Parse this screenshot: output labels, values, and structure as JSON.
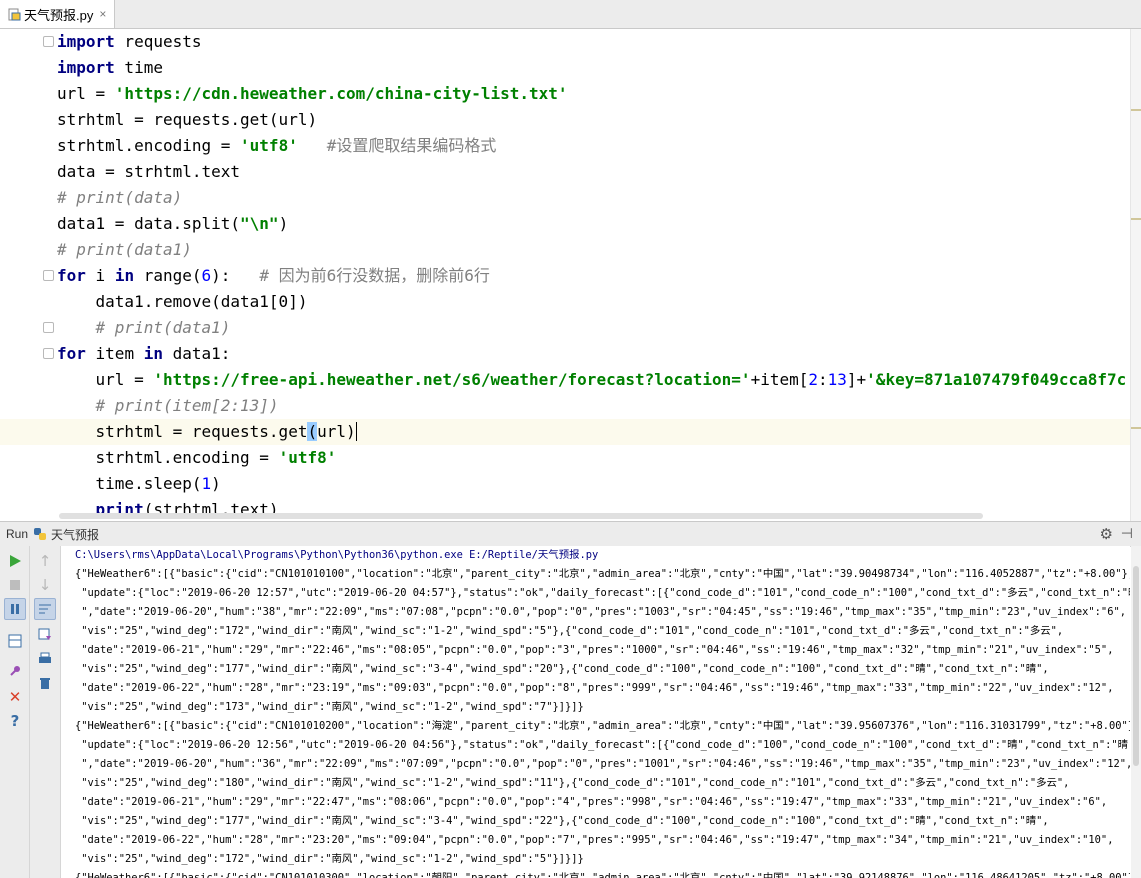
{
  "tab": {
    "filename": "天气预报.py",
    "close": "×"
  },
  "editor": {
    "lines": [
      {
        "segs": [
          [
            "kw",
            "import"
          ],
          [
            "t",
            " requests"
          ]
        ]
      },
      {
        "segs": [
          [
            "kw",
            "import"
          ],
          [
            "t",
            " time"
          ]
        ]
      },
      {
        "segs": [
          [
            "t",
            "url = "
          ],
          [
            "str",
            "'https://cdn.heweather.com/china-city-list.txt'"
          ]
        ]
      },
      {
        "segs": [
          [
            "t",
            "strhtml = requests.get(url)"
          ]
        ]
      },
      {
        "segs": [
          [
            "t",
            "strhtml.encoding = "
          ],
          [
            "str",
            "'utf8'"
          ],
          [
            "t",
            "   "
          ],
          [
            "cmtcn",
            "#设置爬取结果编码格式"
          ]
        ]
      },
      {
        "segs": [
          [
            "t",
            "data = strhtml.text"
          ]
        ]
      },
      {
        "segs": [
          [
            "cmt",
            "# print(data)"
          ]
        ]
      },
      {
        "segs": [
          [
            "t",
            "data1 = data.split("
          ],
          [
            "str",
            "\"\\n\""
          ],
          [
            "t",
            ")"
          ]
        ]
      },
      {
        "segs": [
          [
            "cmt",
            "# print(data1)"
          ]
        ]
      },
      {
        "segs": [
          [
            "kw",
            "for"
          ],
          [
            "t",
            " i "
          ],
          [
            "kw",
            "in"
          ],
          [
            "t",
            " range("
          ],
          [
            "num",
            "6"
          ],
          [
            "t",
            "):   "
          ],
          [
            "cmtcn",
            "# 因为前6行没数据，删除前6行"
          ]
        ]
      },
      {
        "segs": [
          [
            "t",
            "    data1.remove(data1[0])"
          ]
        ]
      },
      {
        "segs": [
          [
            "t",
            "    "
          ],
          [
            "cmt",
            "# print(data1)"
          ]
        ]
      },
      {
        "segs": [
          [
            "kw",
            "for"
          ],
          [
            "t",
            " item "
          ],
          [
            "kw",
            "in"
          ],
          [
            "t",
            " data1:"
          ]
        ]
      },
      {
        "segs": [
          [
            "t",
            "    url = "
          ],
          [
            "str",
            "'https://free-api.heweather.net/s6/weather/forecast?location='"
          ],
          [
            "t",
            "+item["
          ],
          [
            "num",
            "2"
          ],
          [
            "t",
            ":"
          ],
          [
            "num",
            "13"
          ],
          [
            "t",
            "]+"
          ],
          [
            "str",
            "'&key=871a107479f049cca8f7c"
          ]
        ]
      },
      {
        "segs": [
          [
            "t",
            "    "
          ],
          [
            "cmt",
            "# print(item[2:13])"
          ]
        ]
      },
      {
        "segs": [
          [
            "t",
            "    strhtml = requests.get"
          ],
          [
            "br",
            "("
          ],
          [
            "t",
            "url"
          ],
          [
            "brc",
            ")"
          ]
        ]
      },
      {
        "segs": [
          [
            "t",
            "    strhtml.encoding = "
          ],
          [
            "str",
            "'utf8'"
          ]
        ]
      },
      {
        "segs": [
          [
            "t",
            "    time.sleep("
          ],
          [
            "num",
            "1"
          ],
          [
            "t",
            ")"
          ]
        ]
      },
      {
        "segs": [
          [
            "t",
            "    "
          ],
          [
            "kw2",
            "print"
          ],
          [
            "t",
            "(strhtml.text)"
          ]
        ]
      }
    ]
  },
  "run": {
    "label": "Run",
    "config_name": "天气预报",
    "output": [
      "C:\\Users\\rms\\AppData\\Local\\Programs\\Python\\Python36\\python.exe E:/Reptile/天气预报.py",
      "{\"HeWeather6\":[{\"basic\":{\"cid\":\"CN101010100\",\"location\":\"北京\",\"parent_city\":\"北京\",\"admin_area\":\"北京\",\"cnty\":\"中国\",\"lat\":\"39.90498734\",\"lon\":\"116.4052887\",\"tz\":\"+8.00\"},",
      " \"update\":{\"loc\":\"2019-06-20 12:57\",\"utc\":\"2019-06-20 04:57\"},\"status\":\"ok\",\"daily_forecast\":[{\"cond_code_d\":\"101\",\"cond_code_n\":\"100\",\"cond_txt_d\":\"多云\",\"cond_txt_n\":\"晴",
      " \",\"date\":\"2019-06-20\",\"hum\":\"38\",\"mr\":\"22:09\",\"ms\":\"07:08\",\"pcpn\":\"0.0\",\"pop\":\"0\",\"pres\":\"1003\",\"sr\":\"04:45\",\"ss\":\"19:46\",\"tmp_max\":\"35\",\"tmp_min\":\"23\",\"uv_index\":\"6\",",
      " \"vis\":\"25\",\"wind_deg\":\"172\",\"wind_dir\":\"南风\",\"wind_sc\":\"1-2\",\"wind_spd\":\"5\"},{\"cond_code_d\":\"101\",\"cond_code_n\":\"101\",\"cond_txt_d\":\"多云\",\"cond_txt_n\":\"多云\",",
      " \"date\":\"2019-06-21\",\"hum\":\"29\",\"mr\":\"22:46\",\"ms\":\"08:05\",\"pcpn\":\"0.0\",\"pop\":\"3\",\"pres\":\"1000\",\"sr\":\"04:46\",\"ss\":\"19:46\",\"tmp_max\":\"32\",\"tmp_min\":\"21\",\"uv_index\":\"5\",",
      " \"vis\":\"25\",\"wind_deg\":\"177\",\"wind_dir\":\"南风\",\"wind_sc\":\"3-4\",\"wind_spd\":\"20\"},{\"cond_code_d\":\"100\",\"cond_code_n\":\"100\",\"cond_txt_d\":\"晴\",\"cond_txt_n\":\"晴\",",
      " \"date\":\"2019-06-22\",\"hum\":\"28\",\"mr\":\"23:19\",\"ms\":\"09:03\",\"pcpn\":\"0.0\",\"pop\":\"8\",\"pres\":\"999\",\"sr\":\"04:46\",\"ss\":\"19:46\",\"tmp_max\":\"33\",\"tmp_min\":\"22\",\"uv_index\":\"12\",",
      " \"vis\":\"25\",\"wind_deg\":\"173\",\"wind_dir\":\"南风\",\"wind_sc\":\"1-2\",\"wind_spd\":\"7\"}]}]}",
      "{\"HeWeather6\":[{\"basic\":{\"cid\":\"CN101010200\",\"location\":\"海淀\",\"parent_city\":\"北京\",\"admin_area\":\"北京\",\"cnty\":\"中国\",\"lat\":\"39.95607376\",\"lon\":\"116.31031799\",\"tz\":\"+8.00\"},",
      " \"update\":{\"loc\":\"2019-06-20 12:56\",\"utc\":\"2019-06-20 04:56\"},\"status\":\"ok\",\"daily_forecast\":[{\"cond_code_d\":\"100\",\"cond_code_n\":\"100\",\"cond_txt_d\":\"晴\",\"cond_txt_n\":\"晴",
      " \",\"date\":\"2019-06-20\",\"hum\":\"36\",\"mr\":\"22:09\",\"ms\":\"07:09\",\"pcpn\":\"0.0\",\"pop\":\"0\",\"pres\":\"1001\",\"sr\":\"04:46\",\"ss\":\"19:46\",\"tmp_max\":\"35\",\"tmp_min\":\"23\",\"uv_index\":\"12\",",
      " \"vis\":\"25\",\"wind_deg\":\"180\",\"wind_dir\":\"南风\",\"wind_sc\":\"1-2\",\"wind_spd\":\"11\"},{\"cond_code_d\":\"101\",\"cond_code_n\":\"101\",\"cond_txt_d\":\"多云\",\"cond_txt_n\":\"多云\",",
      " \"date\":\"2019-06-21\",\"hum\":\"29\",\"mr\":\"22:47\",\"ms\":\"08:06\",\"pcpn\":\"0.0\",\"pop\":\"4\",\"pres\":\"998\",\"sr\":\"04:46\",\"ss\":\"19:47\",\"tmp_max\":\"33\",\"tmp_min\":\"21\",\"uv_index\":\"6\",",
      " \"vis\":\"25\",\"wind_deg\":\"177\",\"wind_dir\":\"南风\",\"wind_sc\":\"3-4\",\"wind_spd\":\"22\"},{\"cond_code_d\":\"100\",\"cond_code_n\":\"100\",\"cond_txt_d\":\"晴\",\"cond_txt_n\":\"晴\",",
      " \"date\":\"2019-06-22\",\"hum\":\"28\",\"mr\":\"23:20\",\"ms\":\"09:04\",\"pcpn\":\"0.0\",\"pop\":\"7\",\"pres\":\"995\",\"sr\":\"04:46\",\"ss\":\"19:47\",\"tmp_max\":\"34\",\"tmp_min\":\"21\",\"uv_index\":\"10\",",
      " \"vis\":\"25\",\"wind_deg\":\"172\",\"wind_dir\":\"南风\",\"wind_sc\":\"1-2\",\"wind_spd\":\"5\"}]}]}",
      "{\"HeWeather6\":[{\"basic\":{\"cid\":\"CN101010300\",\"location\":\"朝阳\",\"parent_city\":\"北京\",\"admin_area\":\"北京\",\"cnty\":\"中国\",\"lat\":\"39.92148876\",\"lon\":\"116.48641205\",\"tz\":\"+8.00\"},"
    ]
  },
  "icons": {
    "run": "run-icon",
    "stop": "stop-icon",
    "pause": "pause-icon",
    "layout": "layout-icon",
    "pin": "pin-icon",
    "close": "close-icon",
    "help": "help-icon",
    "up": "up-arrow-icon",
    "down": "down-arrow-icon",
    "wrap": "soft-wrap-icon",
    "scroll_end": "scroll-to-end-icon",
    "print": "print-icon",
    "trash": "trash-icon",
    "gear": "gear-icon",
    "minimize": "minimize-icon"
  },
  "colors": {
    "keyword": "#000080",
    "string": "#008000",
    "number": "#0000ff",
    "comment": "#808080",
    "current_line": "#fcfaed"
  }
}
